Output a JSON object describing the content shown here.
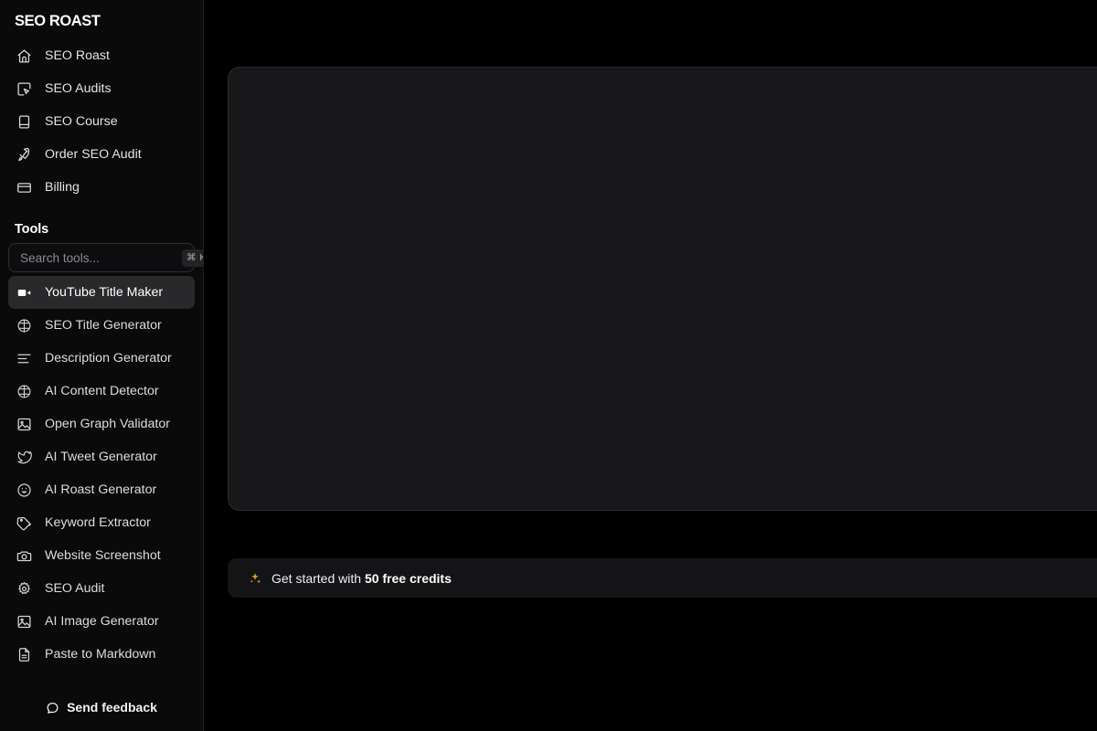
{
  "sidebar": {
    "brand": "SEO ROAST",
    "nav_items": [
      {
        "label": "SEO Roast",
        "icon": "home-icon"
      },
      {
        "label": "SEO Audits",
        "icon": "cursor-square-icon"
      },
      {
        "label": "SEO Course",
        "icon": "book-icon"
      },
      {
        "label": "Order SEO Audit",
        "icon": "rocket-icon"
      },
      {
        "label": "Billing",
        "icon": "credit-card-icon"
      }
    ],
    "tools_header": "Tools",
    "search": {
      "placeholder": "Search tools...",
      "value": "",
      "shortcut": "⌘ K"
    },
    "tools": [
      {
        "label": "YouTube Title Maker",
        "icon": "video-icon",
        "active": true
      },
      {
        "label": "SEO Title Generator",
        "icon": "brain-icon",
        "active": false
      },
      {
        "label": "Description Generator",
        "icon": "align-left-icon",
        "active": false
      },
      {
        "label": "AI Content Detector",
        "icon": "brain-icon",
        "active": false
      },
      {
        "label": "Open Graph Validator",
        "icon": "image-icon",
        "active": false
      },
      {
        "label": "AI Tweet Generator",
        "icon": "twitter-icon",
        "active": false
      },
      {
        "label": "AI Roast Generator",
        "icon": "smiley-icon",
        "active": false
      },
      {
        "label": "Keyword Extractor",
        "icon": "tag-icon",
        "active": false
      },
      {
        "label": "Website Screenshot",
        "icon": "camera-icon",
        "active": false
      },
      {
        "label": "SEO Audit",
        "icon": "gear-icon",
        "active": false
      },
      {
        "label": "AI Image Generator",
        "icon": "image-icon",
        "active": false
      },
      {
        "label": "Paste to Markdown",
        "icon": "file-text-icon",
        "active": false
      }
    ],
    "feedback_label": "Send feedback",
    "feedback_icon": "chat-bubble-icon"
  },
  "main": {
    "credits_banner": {
      "icon": "sparkles-icon",
      "prefix": "Get started with ",
      "highlight": "50 free credits"
    }
  },
  "colors": {
    "page_background": "#000000",
    "sidebar_background": "#0a0a0a",
    "panel_background": "#18181b",
    "panel_border": "#2a2a2e",
    "active_item_background": "#29292c",
    "banner_background": "#141416",
    "accent_gold": "#d9a62e",
    "text_primary": "#ffffff",
    "text_secondary": "#8b8b91"
  }
}
